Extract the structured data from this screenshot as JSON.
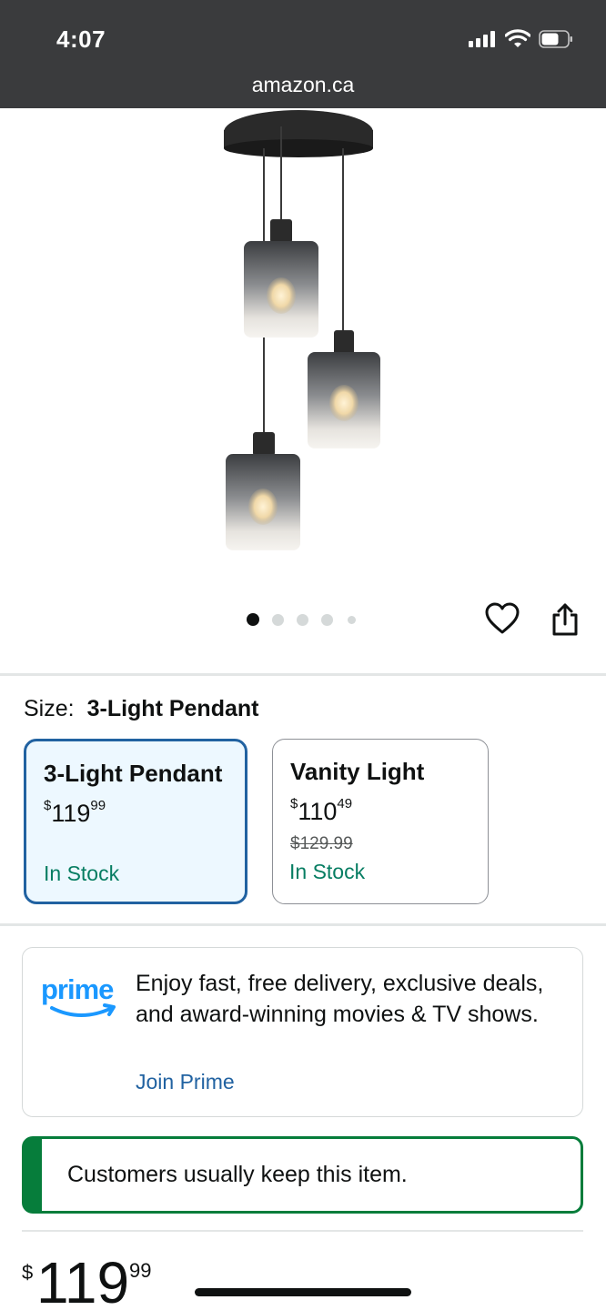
{
  "status_bar": {
    "time": "4:07",
    "url": "amazon.ca",
    "icons": [
      "cellular-signal-icon",
      "wifi-icon",
      "battery-icon"
    ]
  },
  "gallery": {
    "image": "three-light-cluster-pendant-chandelier",
    "dot_count": 5,
    "active_index": 0,
    "icons": [
      "heart-icon",
      "share-icon"
    ]
  },
  "size": {
    "label": "Size:",
    "selected_value": "3-Light Pendant",
    "options": [
      {
        "title": "3-Light Pendant",
        "currency": "$",
        "price_whole": "119",
        "price_fraction": "99",
        "stock": "In Stock",
        "selected": true
      },
      {
        "title": "Vanity Light",
        "currency": "$",
        "price_whole": "110",
        "price_fraction": "49",
        "list_price": "$129.99",
        "stock": "In Stock",
        "selected": false
      }
    ]
  },
  "prime": {
    "logo_text": "prime",
    "text": "Enjoy fast, free delivery, exclusive deals, and award-winning movies & TV shows.",
    "link": "Join Prime"
  },
  "keep_notice": {
    "text": "Customers usually keep this item."
  },
  "price": {
    "currency": "$",
    "whole": "119",
    "fraction": "99"
  },
  "colors": {
    "status_bar_bg": "#3a3b3d",
    "selected_border": "#2162a1",
    "selected_bg": "#edf8ff",
    "in_stock": "#067d62",
    "link": "#2162a1",
    "keep_accent": "#067d3b",
    "prime_blue": "#1a98ff"
  }
}
